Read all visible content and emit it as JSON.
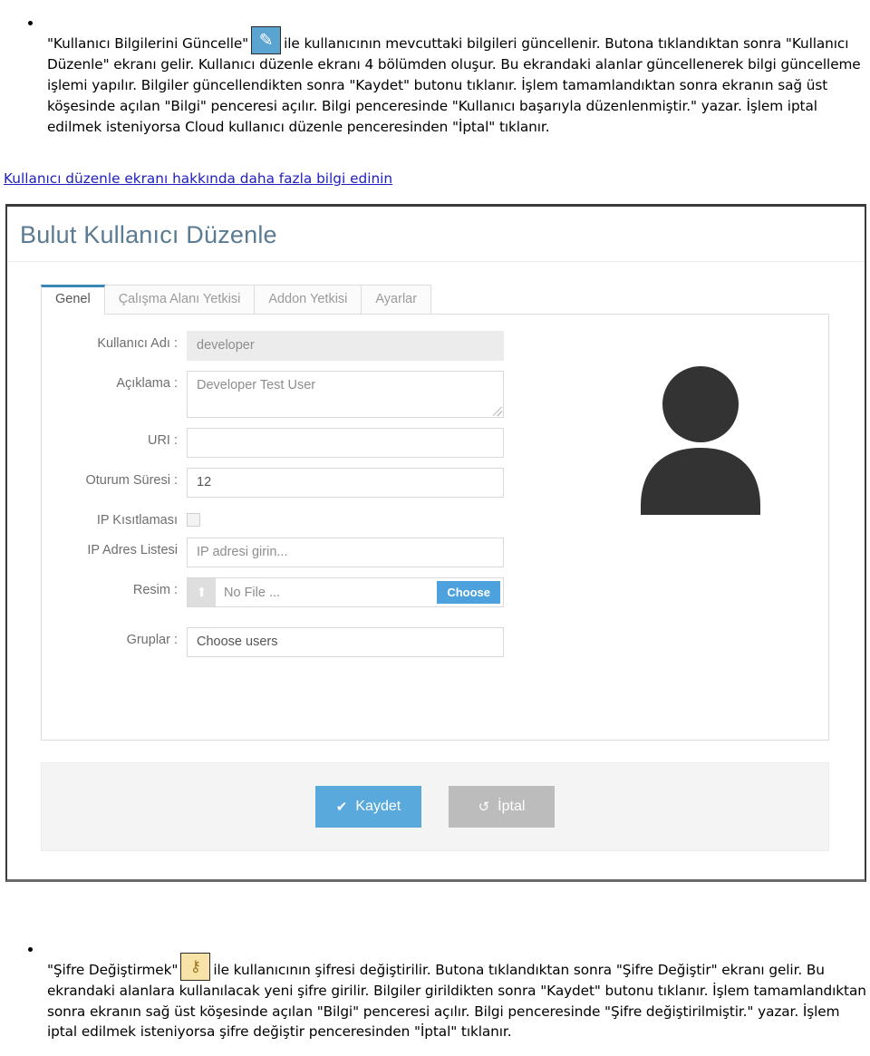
{
  "top_section": {
    "icon": {
      "name": "pencil-icon",
      "glyph": "✎",
      "bg_color": "#5ba3d0"
    },
    "text_before_icon": "\"Kullanıcı Bilgilerini Güncelle\"",
    "text_after_icon": "ile kullanıcının mevcuttaki bilgileri güncellenir. Butona tıklandıktan sonra \"Kullanıcı Düzenle\" ekranı gelir. Kullanıcı düzenle ekranı 4 bölümden oluşur. Bu ekrandaki alanlar güncellenerek bilgi güncelleme işlemi yapılır. Bilgiler güncellendikten sonra \"Kaydet\" butonu tıklanır. İşlem tamamlandıktan sonra ekranın sağ üst köşesinde açılan \"Bilgi\" penceresi açılır. Bilgi penceresinde \"Kullanıcı başarıyla düzenlenmiştir.\" yazar. İşlem iptal edilmek isteniyorsa Cloud kullanıcı düzenle penceresinden \"İptal\" tıklanır."
  },
  "learn_more_link": "Kullanıcı düzenle ekranı hakkında daha fazla bilgi edinin",
  "screenshot": {
    "title": "Bulut Kullanıcı Düzenle",
    "title_color": "#5b7b93",
    "tabs": [
      {
        "label": "Genel",
        "active": true
      },
      {
        "label": "Çalışma Alanı Yetkisi",
        "active": false
      },
      {
        "label": "Addon Yetkisi",
        "active": false
      },
      {
        "label": "Ayarlar",
        "active": false
      }
    ],
    "active_tab_accent": "#3a86b5",
    "fields": {
      "username": {
        "label": "Kullanıcı Adı :",
        "value": "developer",
        "disabled": true
      },
      "description": {
        "label": "Açıklama :",
        "value": "Developer Test User"
      },
      "uri": {
        "label": "URI :",
        "value": ""
      },
      "session_duration": {
        "label": "Oturum Süresi :",
        "value": "12"
      },
      "ip_restriction": {
        "label": "IP Kısıtlaması",
        "checked": false
      },
      "ip_address_list": {
        "label": "IP Adres Listesi",
        "placeholder": "IP adresi girin..."
      },
      "image": {
        "label": "Resim :",
        "file_name": "No File ...",
        "button": "Choose",
        "button_color": "#4da2dd"
      },
      "groups": {
        "label": "Gruplar :",
        "value": "Choose users"
      }
    },
    "avatar_name": "user-avatar-placeholder",
    "buttons": {
      "save": {
        "label": "Kaydet",
        "glyph": "✔",
        "color": "#5aa9dd"
      },
      "cancel": {
        "label": "İptal",
        "glyph": "↺",
        "color": "#bcbcbc"
      }
    }
  },
  "bottom_section": {
    "icon": {
      "name": "key-icon",
      "glyph": "⚷",
      "bg_color": "#f7e2a8"
    },
    "text_before_icon": "\"Şifre Değiştirmek\"",
    "text_after_icon": "ile kullanıcının şifresi değiştirilir. Butona tıklandıktan sonra \"Şifre Değiştir\" ekranı gelir. Bu ekrandaki alanlara kullanılacak yeni şifre girilir. Bilgiler girildikten sonra \"Kaydet\" butonu tıklanır. İşlem tamamlandıktan sonra ekranın sağ üst köşesinde açılan \"Bilgi\" penceresi açılır. Bilgi penceresinde \"Şifre değiştirilmiştir.\" yazar. İşlem iptal edilmek isteniyorsa şifre değiştir penceresinden \"İptal\" tıklanır."
  }
}
